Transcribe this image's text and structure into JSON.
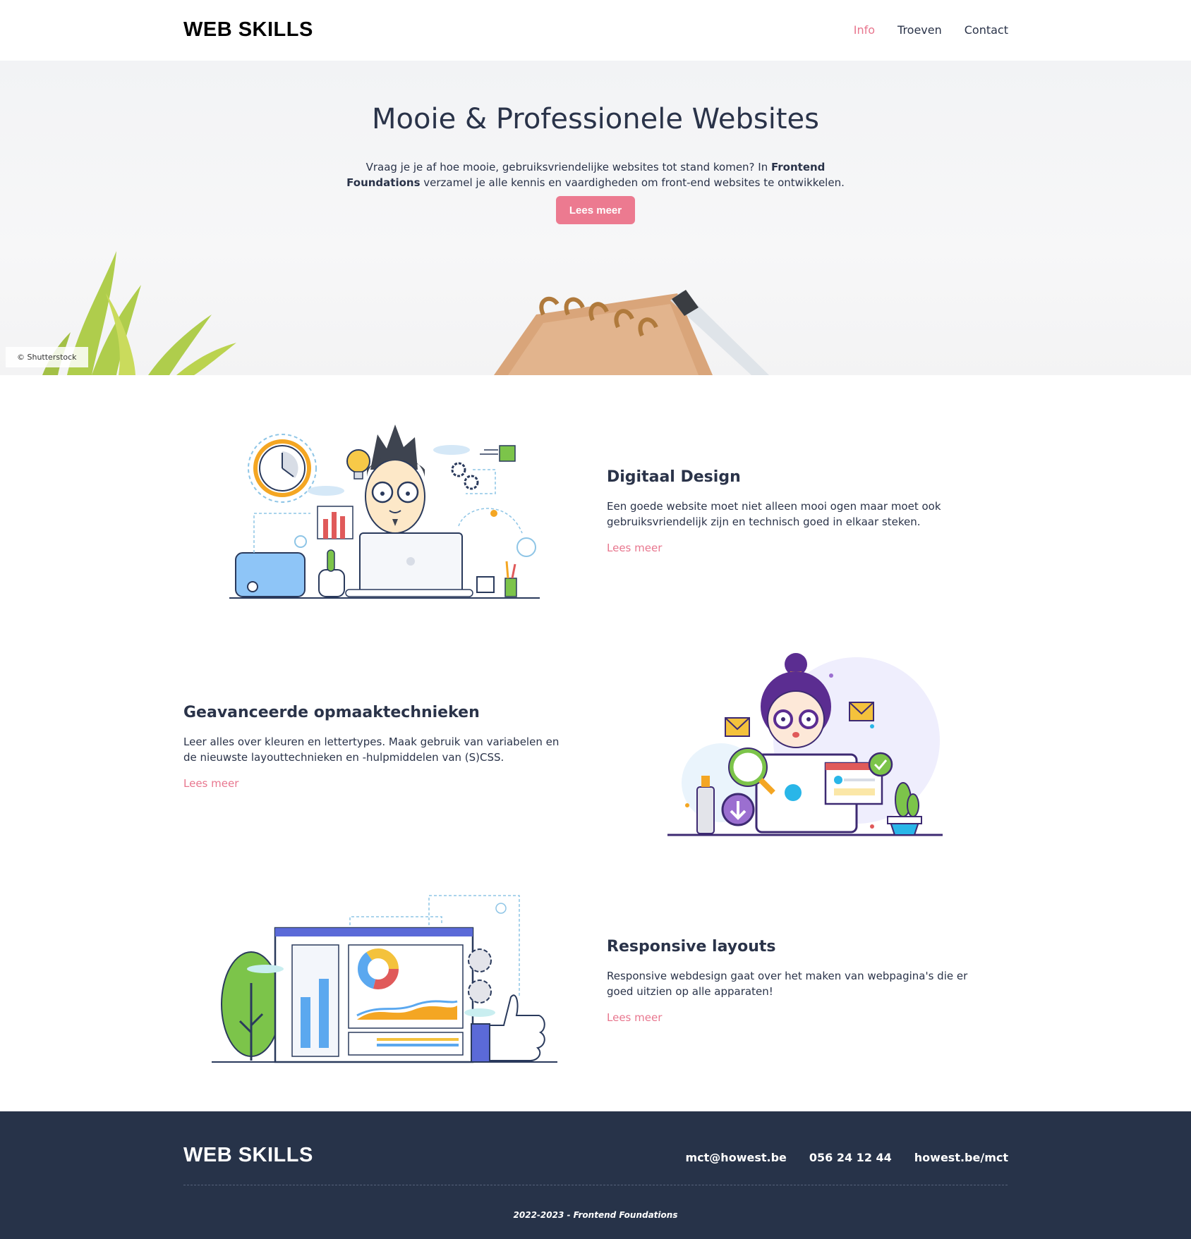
{
  "header": {
    "logo": "WEB SKILLS",
    "nav": [
      {
        "label": "Info",
        "active": true
      },
      {
        "label": "Troeven",
        "active": false
      },
      {
        "label": "Contact",
        "active": false
      }
    ]
  },
  "hero": {
    "title": "Mooie & Professionele Websites",
    "text_before": "Vraag je je af hoe mooie, gebruiksvriendelijke websites tot stand komen? In ",
    "text_bold": "Frontend Foundations",
    "text_after": " verzamel je alle kennis en vaardigheden om front-end websites te ontwikkelen.",
    "button": "Lees meer",
    "credit": "© Shutterstock"
  },
  "features": [
    {
      "title": "Digitaal Design",
      "text": "Een goede website moet niet alleen mooi ogen maar moet ook gebruiksvriendelijk zijn en technisch goed in elkaar steken.",
      "link": "Lees meer",
      "illustration": "man-at-laptop-illustration"
    },
    {
      "title": "Geavanceerde opmaaktechnieken",
      "text": "Leer alles over kleuren en lettertypes. Maak gebruik van variabelen en de nieuwste layouttechnieken en -hulpmiddelen van (S)CSS.",
      "link": "Lees meer",
      "illustration": "woman-at-laptop-illustration"
    },
    {
      "title": "Responsive layouts",
      "text": "Responsive webdesign gaat over het maken van webpagina's die er goed uitzien op alle apparaten!",
      "link": "Lees meer",
      "illustration": "dashboard-thumbs-up-illustration"
    }
  ],
  "footer": {
    "logo": "WEB SKILLS",
    "email": "mct@howest.be",
    "phone": "056 24 12 44",
    "website": "howest.be/mct",
    "copyright": "2022-2023 - Frontend Foundations"
  },
  "colors": {
    "accent": "#e8768e",
    "text": "#2a3349",
    "footer_bg": "#273349"
  }
}
